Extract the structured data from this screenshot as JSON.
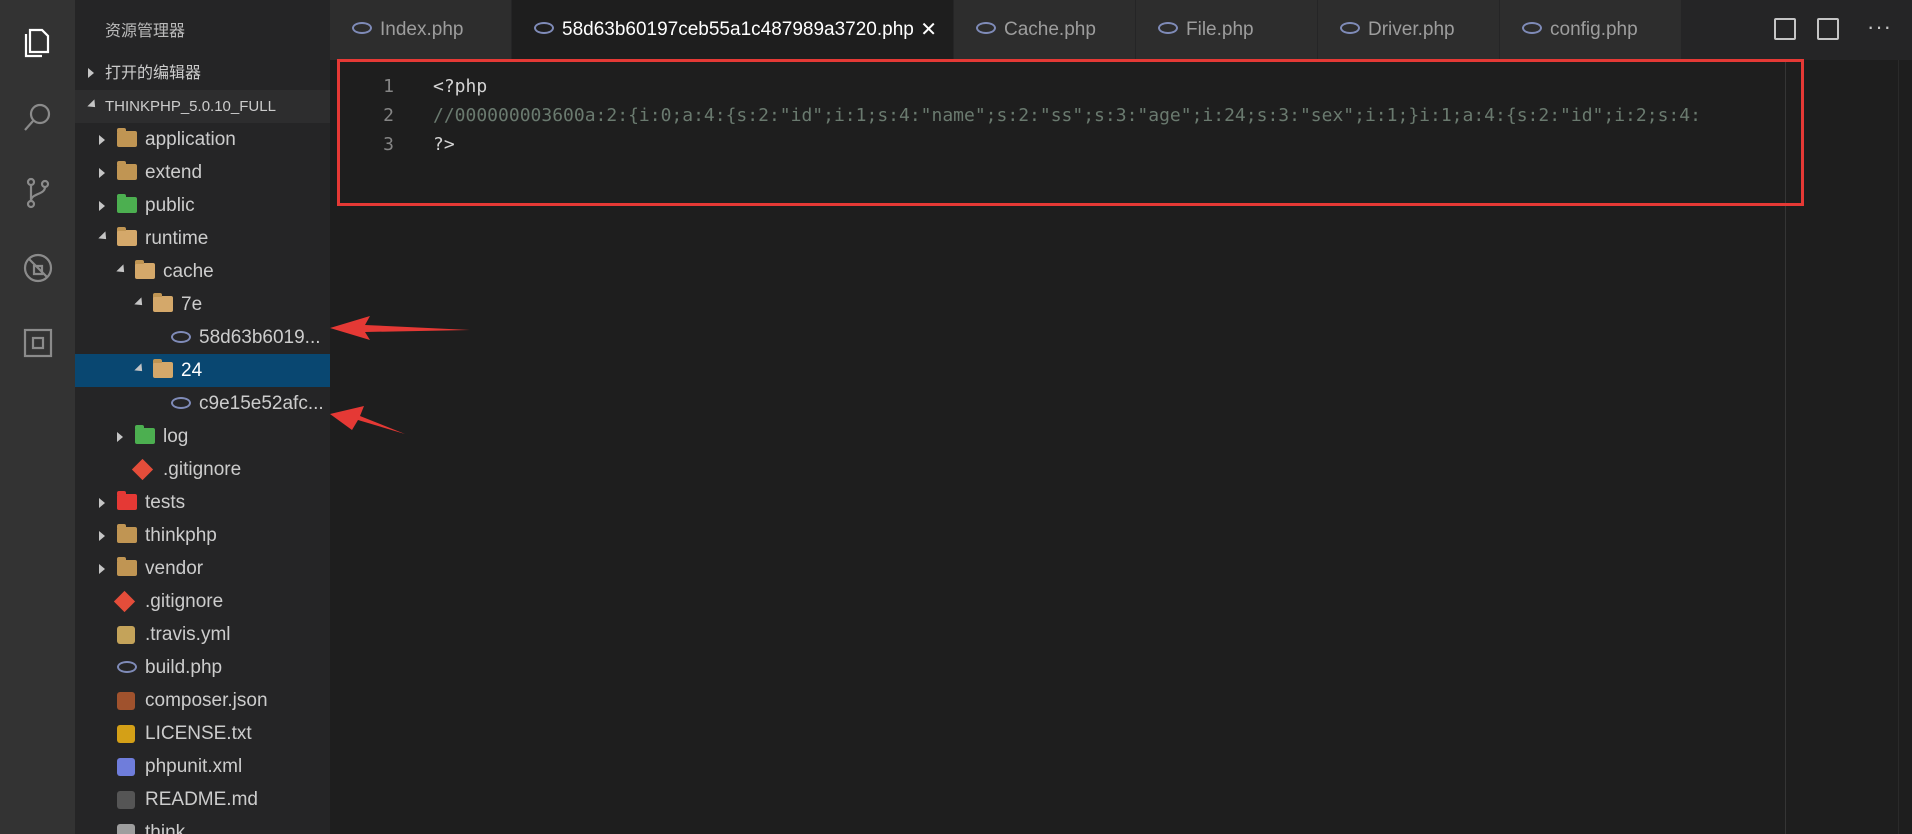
{
  "activity_bar": {
    "icons": [
      "explorer-icon",
      "search-icon",
      "source-control-icon",
      "debug-icon",
      "extensions-icon"
    ]
  },
  "sidebar": {
    "title": "资源管理器",
    "open_editors_label": "打开的编辑器",
    "project_label": "THINKPHP_5.0.10_FULL",
    "tree": [
      {
        "label": "application",
        "depth": 1,
        "kind": "folder"
      },
      {
        "label": "extend",
        "depth": 1,
        "kind": "folder"
      },
      {
        "label": "public",
        "depth": 1,
        "kind": "folder-green"
      },
      {
        "label": "runtime",
        "depth": 1,
        "kind": "folder-open"
      },
      {
        "label": "cache",
        "depth": 2,
        "kind": "folder-open"
      },
      {
        "label": "7e",
        "depth": 3,
        "kind": "folder-open"
      },
      {
        "label": "58d63b6019...",
        "depth": 4,
        "kind": "php"
      },
      {
        "label": "24",
        "depth": 3,
        "kind": "folder-open",
        "selected": true
      },
      {
        "label": "c9e15e52afc...",
        "depth": 4,
        "kind": "php"
      },
      {
        "label": "log",
        "depth": 2,
        "kind": "folder-green"
      },
      {
        "label": ".gitignore",
        "depth": 2,
        "kind": "git"
      },
      {
        "label": "tests",
        "depth": 1,
        "kind": "folder-red"
      },
      {
        "label": "thinkphp",
        "depth": 1,
        "kind": "folder"
      },
      {
        "label": "vendor",
        "depth": 1,
        "kind": "folder"
      },
      {
        "label": ".gitignore",
        "depth": 1,
        "kind": "git"
      },
      {
        "label": ".travis.yml",
        "depth": 1,
        "kind": "travis"
      },
      {
        "label": "build.php",
        "depth": 1,
        "kind": "php"
      },
      {
        "label": "composer.json",
        "depth": 1,
        "kind": "composer"
      },
      {
        "label": "LICENSE.txt",
        "depth": 1,
        "kind": "license"
      },
      {
        "label": "phpunit.xml",
        "depth": 1,
        "kind": "xml"
      },
      {
        "label": "README.md",
        "depth": 1,
        "kind": "md"
      },
      {
        "label": "think",
        "depth": 1,
        "kind": "file"
      }
    ]
  },
  "tabs": [
    {
      "label": "Index.php",
      "active": false
    },
    {
      "label": "58d63b60197ceb55a1c487989a3720.php",
      "active": true,
      "close": "✕"
    },
    {
      "label": "Cache.php",
      "active": false
    },
    {
      "label": "File.php",
      "active": false
    },
    {
      "label": "Driver.php",
      "active": false
    },
    {
      "label": "config.php",
      "active": false
    }
  ],
  "tab_actions": [
    "open-preview-icon",
    "split-editor-icon",
    "more-icon"
  ],
  "editor": {
    "lines": [
      {
        "no": "1",
        "text": "<?php"
      },
      {
        "no": "2",
        "text": "//000000003600a:2:{i:0;a:4:{s:2:\"id\";i:1;s:4:\"name\";s:2:\"ss\";s:3:\"age\";i:24;s:3:\"sex\";i:1;}i:1;a:4:{s:2:\"id\";i:2;s:4:"
      },
      {
        "no": "3",
        "text": "?>"
      }
    ]
  },
  "colors": {
    "accent_red": "#e53935",
    "selected_row": "#094771",
    "editor_bg": "#1e1e1e",
    "sidebar_bg": "#252526"
  }
}
